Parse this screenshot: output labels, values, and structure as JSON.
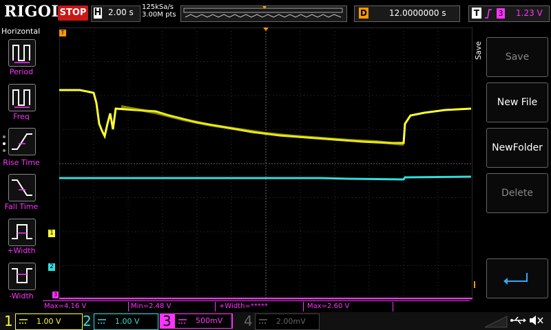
{
  "topbar": {
    "logo": "RIGOL",
    "run_state": "STOP",
    "horizontal_label": "H",
    "timebase": "2.00 s",
    "sample_rate": "125kSa/s",
    "memory_depth": "3.00M pts",
    "delay_label": "D",
    "delay_value": "12.0000000 s",
    "trigger_label": "T",
    "trigger_source": "3",
    "trigger_level": "1.23 V"
  },
  "left_panel": {
    "title": "Horizontal",
    "items": [
      {
        "label": "Period",
        "icon": "period-icon"
      },
      {
        "label": "Freq",
        "icon": "freq-icon"
      },
      {
        "label": "Rise Time",
        "icon": "rise-time-icon"
      },
      {
        "label": "Fall Time",
        "icon": "fall-time-icon"
      },
      {
        "label": "+Width",
        "icon": "pos-width-icon"
      },
      {
        "label": "-Width",
        "icon": "neg-width-icon"
      }
    ]
  },
  "right_panel": {
    "title": "Save",
    "items": [
      {
        "label": "Save",
        "enabled": false
      },
      {
        "label": "New File",
        "enabled": true
      },
      {
        "label": "NewFolder",
        "enabled": true
      },
      {
        "label": "Delete",
        "enabled": false
      },
      {
        "label": "",
        "icon": "enter-icon",
        "enabled": true
      }
    ]
  },
  "measurements": [
    {
      "text": "Max=4.16 V"
    },
    {
      "text": "Min=2.48 V"
    },
    {
      "text": "+Width=*****"
    },
    {
      "text": "Max=2.60 V"
    }
  ],
  "channels": [
    {
      "num": "1",
      "scale": "1.00 V",
      "color": "#ffff33"
    },
    {
      "num": "2",
      "scale": "1.00 V",
      "color": "#33dddd"
    },
    {
      "num": "3",
      "scale": "500mV",
      "color": "#ff33ff"
    },
    {
      "num": "4",
      "scale": "2.00mV",
      "color": "#666666"
    }
  ],
  "markers": {
    "ch1": "1",
    "ch2": "2",
    "ch3": "3",
    "trigger": "T"
  },
  "colors": {
    "ch1": "#ffff33",
    "ch2": "#33dddd",
    "ch3": "#ff33ff",
    "accent": "#ff9900",
    "stop": "#c81818"
  }
}
